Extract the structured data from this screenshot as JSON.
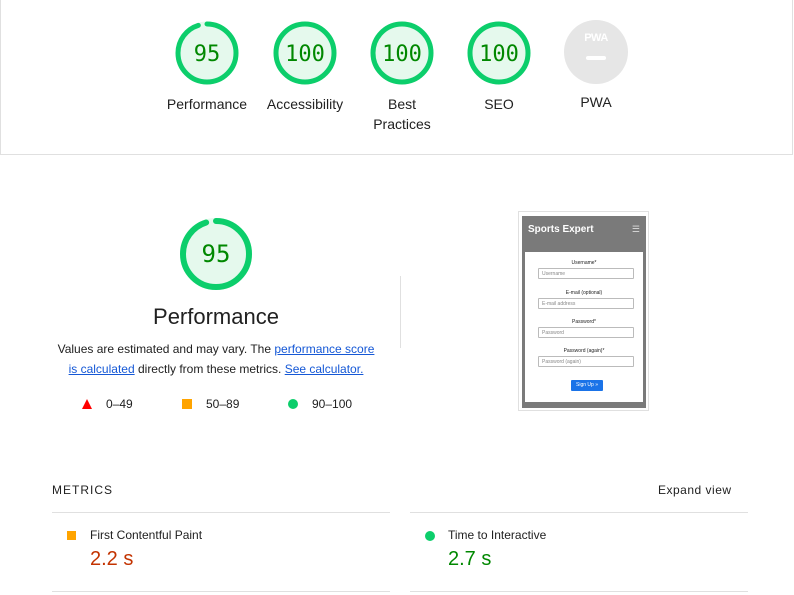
{
  "gauges": [
    {
      "score": "95",
      "label": "Performance",
      "fraction": 0.95,
      "color": "#0cce6b"
    },
    {
      "score": "100",
      "label": "Accessibility",
      "fraction": 1.0,
      "color": "#0cce6b"
    },
    {
      "score": "100",
      "label": "Best Practices",
      "fraction": 1.0,
      "color": "#0cce6b"
    },
    {
      "score": "100",
      "label": "SEO",
      "fraction": 1.0,
      "color": "#0cce6b"
    }
  ],
  "pwa": {
    "badge_text": "PWA",
    "label": "PWA"
  },
  "performance": {
    "score": "95",
    "fraction": 0.95,
    "title": "Performance",
    "desc_prefix": "Values are estimated and may vary. The ",
    "desc_link1": "performance score is calculated",
    "desc_middle": " directly from these metrics. ",
    "desc_link2": "See calculator."
  },
  "legend": {
    "fail": "0–49",
    "average": "50–89",
    "pass": "90–100",
    "colors": {
      "fail": "#ff0000",
      "average": "#ffa400",
      "pass": "#0cce6b"
    }
  },
  "screenshot": {
    "brand": "Sports Expert",
    "menu_icon": "hamburger-icon",
    "fields": [
      {
        "label": "Username*",
        "placeholder": "Username"
      },
      {
        "label": "E-mail (optional)",
        "placeholder": "E-mail address"
      },
      {
        "label": "Password*",
        "placeholder": "Password"
      },
      {
        "label": "Password (again)*",
        "placeholder": "Password (again)"
      }
    ],
    "button": "Sign Up »"
  },
  "metrics": {
    "heading": "METRICS",
    "expand_label": "Expand view",
    "items": [
      {
        "title": "First Contentful Paint",
        "value": "2.2 s",
        "status": "average",
        "value_color": "#c33300"
      },
      {
        "title": "Time to Interactive",
        "value": "2.7 s",
        "status": "pass",
        "value_color": "#008800"
      }
    ]
  }
}
